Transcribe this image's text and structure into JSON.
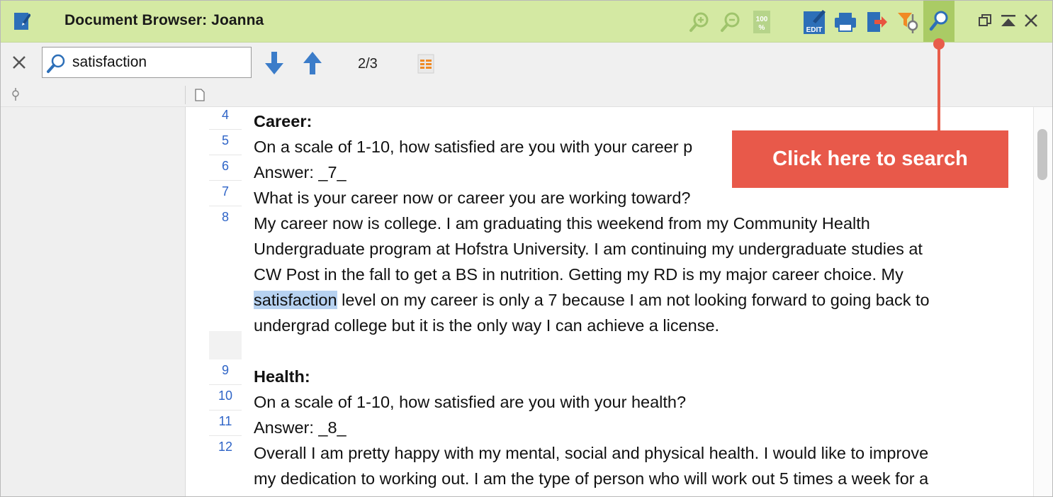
{
  "window": {
    "title": "Document Browser: Joanna"
  },
  "toolbar": {
    "zoom_in_icon": "zoom-in-icon",
    "zoom_out_icon": "zoom-out-icon",
    "zoom_100_label": "100 %",
    "edit_label": "EDIT",
    "icons": [
      "edit-icon",
      "print-icon",
      "export-icon",
      "filter-icon",
      "search-icon"
    ]
  },
  "search": {
    "value": "satisfaction",
    "counter": "2/3"
  },
  "lines": [
    {
      "num": "4",
      "text": "Career:",
      "bold": true
    },
    {
      "num": "5",
      "text": "On a scale of 1-10, how satisfied are you with your career p"
    },
    {
      "num": "6",
      "text": "Answer: _7_"
    },
    {
      "num": "7",
      "text": "What is your career now or career you are working toward?"
    },
    {
      "num": "8",
      "text": "My career now is college. I am graduating this weekend from my Community Health"
    },
    {
      "num": "",
      "text": "Undergraduate program at Hofstra University.  I am continuing my undergraduate studies at"
    },
    {
      "num": "",
      "text": "CW Post in the fall to get a BS in nutrition.  Getting my RD is my major career choice.  My"
    },
    {
      "num": "",
      "highlight": "satisfaction",
      "text": " level on my career is only a 7 because I am not looking forward to going back to"
    },
    {
      "num": "",
      "text": "undergrad college but it is the only way I can achieve a license."
    },
    {
      "num": "9",
      "text": "Health:",
      "bold": true
    },
    {
      "num": "10",
      "text": "On a scale of 1-10, how satisfied are you with your health?"
    },
    {
      "num": "11",
      "text": "Answer: _8_"
    },
    {
      "num": "12",
      "text": "Overall I am pretty happy with my mental, social and physical health.  I would like to improve"
    },
    {
      "num": "",
      "text": "my dedication to working out.  I am the type of person who will work out 5 times a week for a"
    }
  ],
  "annotation": {
    "text": "Click here to search",
    "color": "#e8594a"
  },
  "colors": {
    "titlebar": "#d4e9a3",
    "active_button": "#aacb65",
    "highlight": "#b7d2f1",
    "line_number": "#2e64c7"
  }
}
